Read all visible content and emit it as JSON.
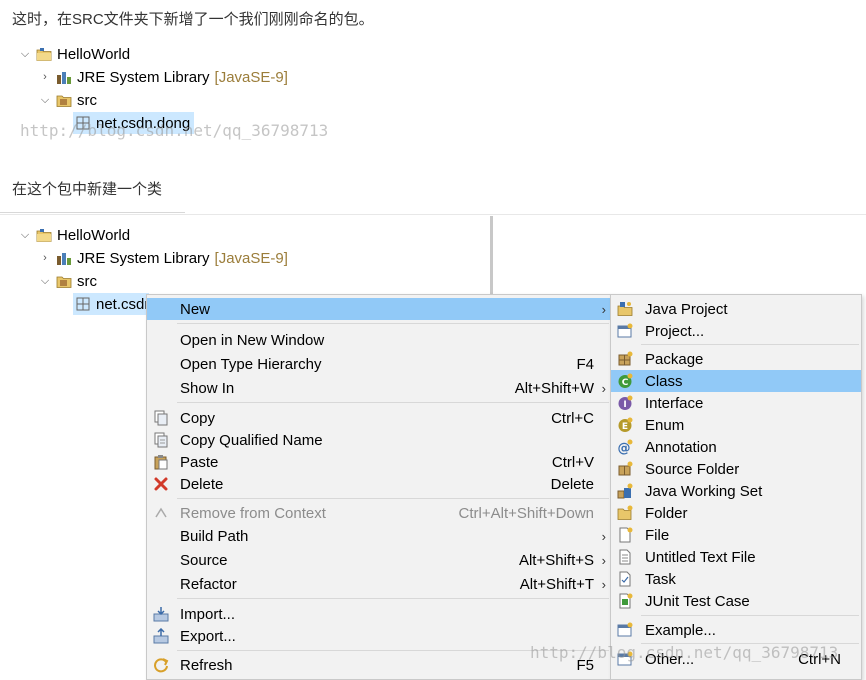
{
  "intro_text": "这时，在SRC文件夹下新增了一个我们刚刚命名的包。",
  "second_text": "在这个包中新建一个类",
  "watermark_top": "http://blog.csdn.net/qq_36798713",
  "watermark_bottom": "http://blog.csdn.net/qq_36798713",
  "tree1": {
    "project": "HelloWorld",
    "jre_label": "JRE System Library",
    "jre_deco": "[JavaSE-9]",
    "src": "src",
    "package": "net.csdn.dong"
  },
  "tree2": {
    "project": "HelloWorld",
    "jre_label": "JRE System Library",
    "jre_deco": "[JavaSE-9]",
    "src": "src",
    "package": "net.csdn"
  },
  "context_menu": {
    "new": "New",
    "open_new_window": "Open in New Window",
    "open_type_hierarchy": "Open Type Hierarchy",
    "open_type_hierarchy_acc": "F4",
    "show_in": "Show In",
    "show_in_acc": "Alt+Shift+W",
    "copy": "Copy",
    "copy_acc": "Ctrl+C",
    "copy_qualified": "Copy Qualified Name",
    "paste": "Paste",
    "paste_acc": "Ctrl+V",
    "delete": "Delete",
    "delete_acc": "Delete",
    "remove_context": "Remove from Context",
    "remove_context_acc": "Ctrl+Alt+Shift+Down",
    "build_path": "Build Path",
    "source": "Source",
    "source_acc": "Alt+Shift+S",
    "refactor": "Refactor",
    "refactor_acc": "Alt+Shift+T",
    "import": "Import...",
    "export": "Export...",
    "refresh": "Refresh",
    "refresh_acc": "F5"
  },
  "new_submenu": {
    "java_project": "Java Project",
    "project": "Project...",
    "package": "Package",
    "class": "Class",
    "interface": "Interface",
    "enum": "Enum",
    "annotation": "Annotation",
    "source_folder": "Source Folder",
    "java_working_set": "Java Working Set",
    "folder": "Folder",
    "file": "File",
    "untitled_text_file": "Untitled Text File",
    "task": "Task",
    "junit_test_case": "JUnit Test Case",
    "example": "Example...",
    "other": "Other...",
    "other_acc": "Ctrl+N"
  },
  "colors": {
    "menu_highlight": "#91c9f7",
    "tree_selection": "#cce8ff",
    "decoration": "#9b7d3a"
  }
}
